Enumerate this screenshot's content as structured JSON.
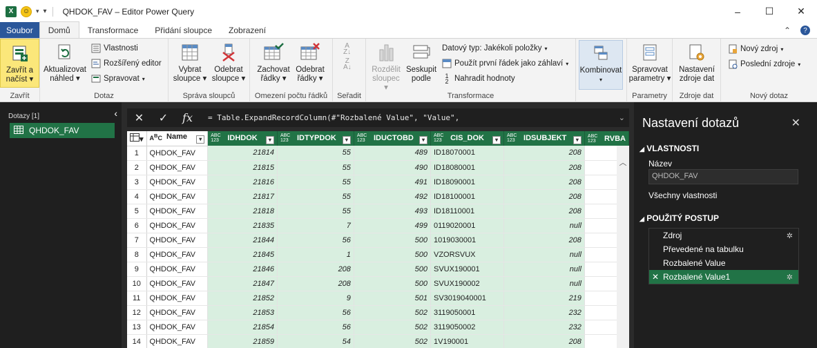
{
  "window": {
    "title": "QHDOK_FAV – Editor Power Query",
    "app_icon": "X",
    "controls": [
      "–",
      "☐",
      "✕"
    ]
  },
  "tabs": {
    "file": "Soubor",
    "items": [
      "Domů",
      "Transformace",
      "Přidání sloupce",
      "Zobrazení"
    ],
    "active": "Domů"
  },
  "ribbon": {
    "close": {
      "btn": "Zavřít a\nnačíst",
      "label": "Zavřít"
    },
    "query": {
      "refresh": "Aktualizovat\nnáhled",
      "properties": "Vlastnosti",
      "advanced": "Rozšířený editor",
      "manage": "Spravovat",
      "label": "Dotaz"
    },
    "columns": {
      "choose": "Vybrat\nsloupce",
      "remove": "Odebrat\nsloupce",
      "label": "Správa sloupců"
    },
    "rows": {
      "keep": "Zachovat\nřádky",
      "remove": "Odebrat\nřádky",
      "label": "Omezení počtu řádků"
    },
    "sort": {
      "label": "Seřadit"
    },
    "transform": {
      "split": "Rozdělit\nsloupec",
      "group": "Seskupit\npodle",
      "datatype": "Datový typ: Jakékoli položky",
      "first_row": "Použít první řádek jako záhlaví",
      "replace": "Nahradit hodnoty",
      "label": "Transformace"
    },
    "combine": {
      "btn": "Kombinovat"
    },
    "params": {
      "btn": "Spravovat\nparametry",
      "label": "Parametry"
    },
    "datasources": {
      "btn": "Nastavení\nzdroje dat",
      "label": "Zdroje dat"
    },
    "newquery": {
      "new_source": "Nový zdroj",
      "recent": "Poslední zdroje",
      "label": "Nový dotaz"
    }
  },
  "left_pane": {
    "header": "Dotazy [1]",
    "items": [
      "QHDOK_FAV"
    ]
  },
  "formula_bar": {
    "cancel": "✕",
    "confirm": "✓",
    "fx": "fx",
    "formula": "= Table.ExpandRecordColumn(#\"Rozbalené Value\", \"Value\","
  },
  "grid": {
    "columns": [
      "Name",
      "IDHDOK",
      "IDTYPDOK",
      "IDUCTOBD",
      "CIS_DOK",
      "IDSUBJEKT",
      "RVBA"
    ],
    "column_types": [
      "ABC",
      "ABC 123",
      "ABC 123",
      "ABC 123",
      "ABC 123",
      "ABC 123",
      "ABC 123"
    ],
    "rows": [
      [
        "1",
        "QHDOK_FAV",
        "21814",
        "55",
        "489",
        "ID18070001",
        "208"
      ],
      [
        "2",
        "QHDOK_FAV",
        "21815",
        "55",
        "490",
        "ID18080001",
        "208"
      ],
      [
        "3",
        "QHDOK_FAV",
        "21816",
        "55",
        "491",
        "ID18090001",
        "208"
      ],
      [
        "4",
        "QHDOK_FAV",
        "21817",
        "55",
        "492",
        "ID18100001",
        "208"
      ],
      [
        "5",
        "QHDOK_FAV",
        "21818",
        "55",
        "493",
        "ID18110001",
        "208"
      ],
      [
        "6",
        "QHDOK_FAV",
        "21835",
        "7",
        "499",
        "0119020001",
        "null"
      ],
      [
        "7",
        "QHDOK_FAV",
        "21844",
        "56",
        "500",
        "1019030001",
        "208"
      ],
      [
        "8",
        "QHDOK_FAV",
        "21845",
        "1",
        "500",
        "VZORSVUX",
        "null"
      ],
      [
        "9",
        "QHDOK_FAV",
        "21846",
        "208",
        "500",
        "SVUX190001",
        "null"
      ],
      [
        "10",
        "QHDOK_FAV",
        "21847",
        "208",
        "500",
        "SVUX190002",
        "null"
      ],
      [
        "11",
        "QHDOK_FAV",
        "21852",
        "9",
        "501",
        "SV3019040001",
        "219"
      ],
      [
        "12",
        "QHDOK_FAV",
        "21853",
        "56",
        "502",
        "3119050001",
        "232"
      ],
      [
        "13",
        "QHDOK_FAV",
        "21854",
        "56",
        "502",
        "3119050002",
        "232"
      ],
      [
        "14",
        "QHDOK_FAV",
        "21859",
        "54",
        "502",
        "1V190001",
        "208"
      ]
    ]
  },
  "right_pane": {
    "title": "Nastavení dotazů",
    "properties_header": "VLASTNOSTI",
    "name_label": "Název",
    "name_value": "QHDOK_FAV",
    "all_props": "Všechny vlastnosti",
    "steps_header": "POUŽITÝ POSTUP",
    "steps": [
      "Zdroj",
      "Převedené na tabulku",
      "Rozbalené Value",
      "Rozbalené Value1"
    ],
    "active_step": "Rozbalené Value1"
  }
}
